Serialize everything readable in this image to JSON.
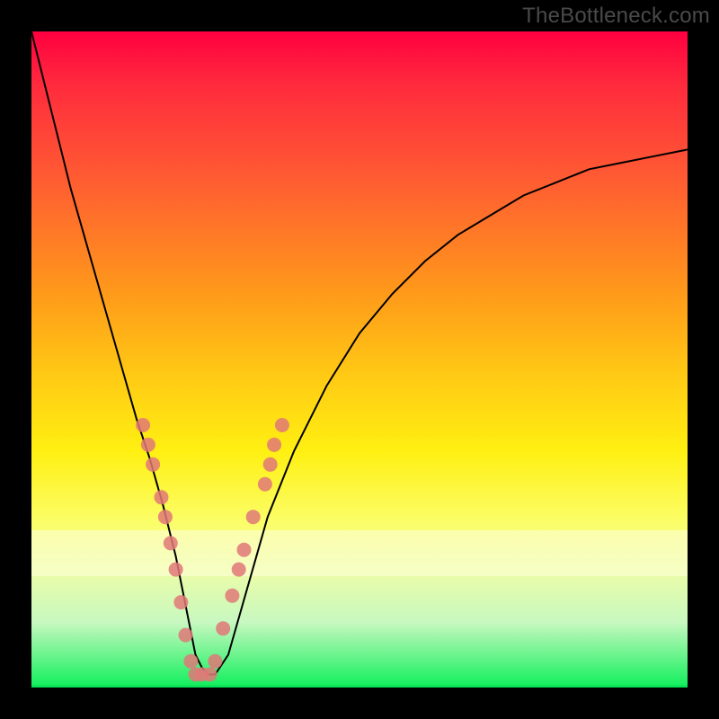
{
  "watermark": "TheBottleneck.com",
  "colors": {
    "marker": "#e07878",
    "curve": "#000000",
    "gradient_top": "#ff0040",
    "gradient_bottom": "#00d850",
    "frame": "#000000"
  },
  "chart_data": {
    "type": "line",
    "title": "",
    "xlabel": "",
    "ylabel": "",
    "xlim": [
      0,
      100
    ],
    "ylim": [
      0,
      100
    ],
    "series": [
      {
        "name": "bottleneck-curve",
        "x": [
          0,
          2,
          4,
          6,
          8,
          10,
          12,
          14,
          16,
          18,
          20,
          22,
          23,
          24,
          25,
          26,
          27,
          28,
          30,
          32,
          34,
          36,
          40,
          45,
          50,
          55,
          60,
          65,
          70,
          75,
          80,
          85,
          90,
          95,
          100
        ],
        "y": [
          100,
          92,
          84,
          76,
          69,
          62,
          55,
          48,
          41,
          35,
          28,
          20,
          15,
          10,
          5,
          3,
          2,
          2,
          5,
          12,
          19,
          26,
          36,
          46,
          54,
          60,
          65,
          69,
          72,
          75,
          77,
          79,
          80,
          81,
          82
        ]
      }
    ],
    "markers": [
      {
        "x": 17.0,
        "y": 40
      },
      {
        "x": 17.8,
        "y": 37
      },
      {
        "x": 18.5,
        "y": 34
      },
      {
        "x": 19.8,
        "y": 29
      },
      {
        "x": 20.4,
        "y": 26
      },
      {
        "x": 21.2,
        "y": 22
      },
      {
        "x": 22.0,
        "y": 18
      },
      {
        "x": 22.8,
        "y": 13
      },
      {
        "x": 23.5,
        "y": 8
      },
      {
        "x": 24.3,
        "y": 4
      },
      {
        "x": 25.0,
        "y": 2
      },
      {
        "x": 26.0,
        "y": 2
      },
      {
        "x": 27.2,
        "y": 2
      },
      {
        "x": 28.0,
        "y": 4
      },
      {
        "x": 29.2,
        "y": 9
      },
      {
        "x": 30.6,
        "y": 14
      },
      {
        "x": 31.6,
        "y": 18
      },
      {
        "x": 32.4,
        "y": 21
      },
      {
        "x": 33.8,
        "y": 26
      },
      {
        "x": 35.6,
        "y": 31
      },
      {
        "x": 36.4,
        "y": 34
      },
      {
        "x": 37.0,
        "y": 37
      },
      {
        "x": 38.2,
        "y": 40
      }
    ],
    "marker_radius": 8
  }
}
